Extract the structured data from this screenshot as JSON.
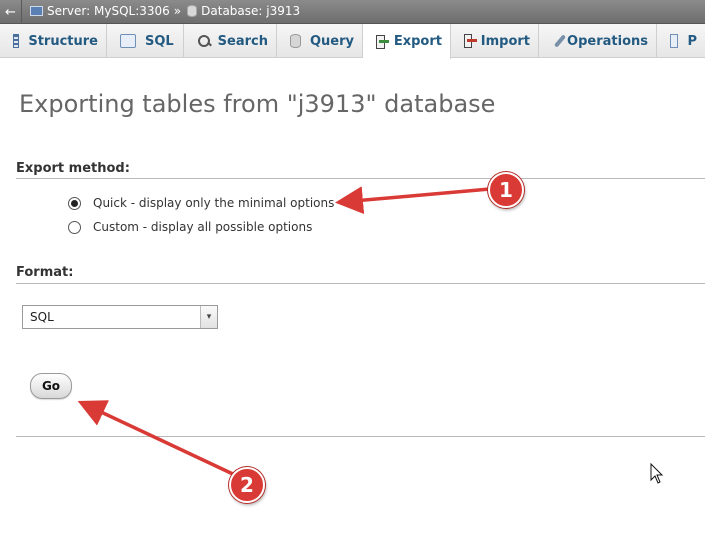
{
  "breadcrumb": {
    "back_arrow": "←",
    "server": "Server: MySQL:3306",
    "separator": "»",
    "database": "Database: j3913"
  },
  "tabs": [
    {
      "label": "Structure",
      "icon": "structure-icon"
    },
    {
      "label": "SQL",
      "icon": "sql-icon"
    },
    {
      "label": "Search",
      "icon": "search-icon"
    },
    {
      "label": "Query",
      "icon": "query-icon"
    },
    {
      "label": "Export",
      "icon": "export-icon",
      "active": true
    },
    {
      "label": "Import",
      "icon": "import-icon"
    },
    {
      "label": "Operations",
      "icon": "operations-icon"
    },
    {
      "label": "P",
      "icon": "privileges-icon"
    }
  ],
  "page": {
    "title": "Exporting tables from \"j3913\" database"
  },
  "export_method": {
    "label": "Export method:",
    "options": [
      {
        "label": "Quick - display only the minimal options",
        "checked": true
      },
      {
        "label": "Custom - display all possible options",
        "checked": false
      }
    ]
  },
  "format": {
    "label": "Format:",
    "selected": "SQL",
    "arrow": "▾"
  },
  "go_button": {
    "label": "Go"
  },
  "annotations": {
    "callout_1": "1",
    "callout_2": "2",
    "color": "#d93a35"
  }
}
